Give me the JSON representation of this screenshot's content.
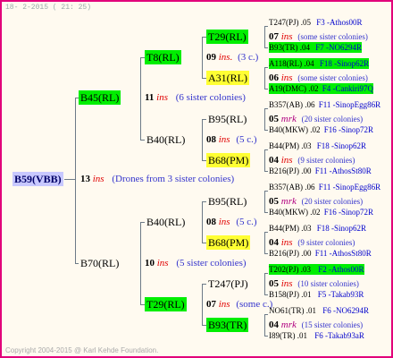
{
  "header": {
    "date": "18-  2-2015 ( 21: 25)"
  },
  "footer": {
    "copyright": "Copyright 2004-2015 @ Karl Kehde Foundation."
  },
  "root": {
    "label": "B59(VBB)",
    "count": "13",
    "ins": "ins",
    "note": "(Drones from 3 sister colonies)"
  },
  "upper": {
    "parent": {
      "label": "B45(RL)",
      "count": "11",
      "ins": "ins",
      "note": "(6 sister colonies)"
    },
    "a": {
      "label": "T8(RL)",
      "count": "09",
      "ins": "ins.",
      "note": "(3 c.)",
      "top": {
        "label": "T29(RL)",
        "count": "07",
        "ins": "ins",
        "note": "(some sister colonies)",
        "l1": {
          "name": "T247(PJ) .05",
          "sire": "F3 -Athos00R"
        },
        "l2": {
          "name": "B93(TR) .04",
          "sire": "F7 -NO6294R"
        }
      },
      "bot": {
        "label": "A31(RL)",
        "count": "06",
        "ins": "ins",
        "note": "(some sister colonies)",
        "l1": {
          "name": "A118(RL) .04",
          "sire": "F18 -Sinop62R"
        },
        "l2": {
          "name": "A19(DMC) .02",
          "sire": "F4 -Cankiri97Q"
        }
      }
    },
    "b": {
      "label": "B40(RL)",
      "count": "08",
      "ins": "ins",
      "note": "(5 c.)",
      "top": {
        "label": "B95(RL)",
        "count": "05",
        "ins": "mrk",
        "note": "(20 sister colonies)",
        "l1": {
          "name": "B357(AB) .06",
          "sire": "F11 -SinopEgg86R"
        },
        "l2": {
          "name": "B40(MKW) .02",
          "sire": "F16 -Sinop72R"
        }
      },
      "bot": {
        "label": "B68(PM)",
        "count": "04",
        "ins": "ins",
        "note": "(9 sister colonies)",
        "l1": {
          "name": "B44(PM) .03",
          "sire": "F18 -Sinop62R"
        },
        "l2": {
          "name": "B216(PJ) .00",
          "sire": "F11 -AthosSt80R"
        }
      }
    }
  },
  "lower": {
    "parent": {
      "label": "B70(RL)",
      "count": "10",
      "ins": "ins",
      "note": "(5 sister colonies)"
    },
    "a": {
      "label": "B40(RL)",
      "count": "08",
      "ins": "ins",
      "note": "(5 c.)",
      "top": {
        "label": "B95(RL)",
        "count": "05",
        "ins": "mrk",
        "note": "(20 sister colonies)",
        "l1": {
          "name": "B357(AB) .06",
          "sire": "F11 -SinopEgg86R"
        },
        "l2": {
          "name": "B40(MKW) .02",
          "sire": "F16 -Sinop72R"
        }
      },
      "bot": {
        "label": "B68(PM)",
        "count": "04",
        "ins": "ins",
        "note": "(9 sister colonies)",
        "l1": {
          "name": "B44(PM) .03",
          "sire": "F18 -Sinop62R"
        },
        "l2": {
          "name": "B216(PJ) .00",
          "sire": "F11 -AthosSt80R"
        }
      }
    },
    "b": {
      "label": "T29(RL)",
      "count": "07",
      "ins": "ins",
      "note": "(some c.)",
      "top": {
        "label": "T247(PJ)",
        "count": "05",
        "ins": "ins",
        "note": "(10 sister colonies)",
        "l1": {
          "name": "T202(PJ) .03",
          "sire": "F2 -Athos00R"
        },
        "l2": {
          "name": "B158(PJ) .01",
          "sire": "F5 -Takab93R"
        }
      },
      "bot": {
        "label": "B93(TR)",
        "count": "04",
        "ins": "mrk",
        "note": "(15 sister colonies)",
        "l1": {
          "name": "NO61(TR) .01",
          "sire": "F6 -NO6294R"
        },
        "l2": {
          "name": "I89(TR) .01",
          "sire": "F6 -Takab93aR"
        }
      }
    }
  }
}
